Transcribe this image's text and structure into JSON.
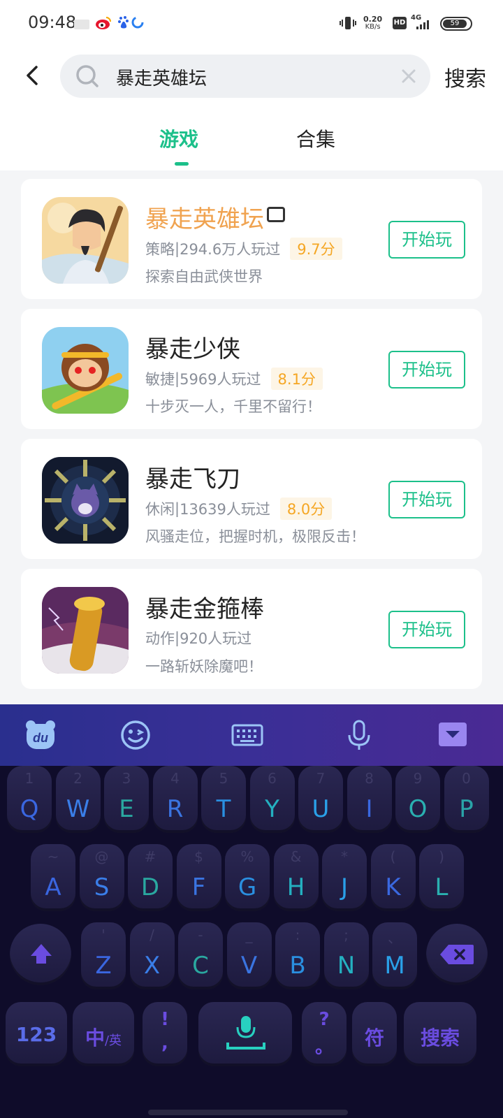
{
  "status": {
    "time": "09:48",
    "net_speed": "0.20",
    "net_unit": "KB/s",
    "hd": "HD",
    "signal": "4G",
    "battery": "59"
  },
  "header": {
    "search_value": "暴走英雄坛",
    "search_button": "搜索"
  },
  "tabs": [
    {
      "label": "游戏",
      "active": true
    },
    {
      "label": "合集",
      "active": false
    }
  ],
  "games": [
    {
      "name": "暴走英雄坛",
      "category": "策略",
      "players": "294.6万人玩过",
      "score": "9.7分",
      "desc": "探索自由武侠世界",
      "button": "开始玩"
    },
    {
      "name": "暴走少侠",
      "category": "敏捷",
      "players": "5969人玩过",
      "score": "8.1分",
      "desc": "十步灭一人，千里不留行！",
      "button": "开始玩"
    },
    {
      "name": "暴走飞刀",
      "category": "休闲",
      "players": "13639人玩过",
      "score": "8.0分",
      "desc": "风骚走位，把握时机，极限反击！",
      "button": "开始玩"
    },
    {
      "name": "暴走金箍棒",
      "category": "动作",
      "players": "920人玩过",
      "score": "",
      "desc": "一路斩妖除魔吧！",
      "button": "开始玩"
    }
  ],
  "meta_sep": " | ",
  "keyboard": {
    "row1": [
      {
        "k": "Q",
        "s": "1"
      },
      {
        "k": "W",
        "s": "2"
      },
      {
        "k": "E",
        "s": "3"
      },
      {
        "k": "R",
        "s": "4"
      },
      {
        "k": "T",
        "s": "5"
      },
      {
        "k": "Y",
        "s": "6"
      },
      {
        "k": "U",
        "s": "7"
      },
      {
        "k": "I",
        "s": "8"
      },
      {
        "k": "O",
        "s": "9"
      },
      {
        "k": "P",
        "s": "0"
      }
    ],
    "row2": [
      {
        "k": "A",
        "s": "~"
      },
      {
        "k": "S",
        "s": "@"
      },
      {
        "k": "D",
        "s": "#"
      },
      {
        "k": "F",
        "s": "$"
      },
      {
        "k": "G",
        "s": "%"
      },
      {
        "k": "H",
        "s": "&"
      },
      {
        "k": "J",
        "s": "*"
      },
      {
        "k": "K",
        "s": "("
      },
      {
        "k": "L",
        "s": ")"
      }
    ],
    "row3": [
      {
        "k": "Z",
        "s": "'"
      },
      {
        "k": "X",
        "s": "/"
      },
      {
        "k": "C",
        "s": "-"
      },
      {
        "k": "V",
        "s": "_"
      },
      {
        "k": "B",
        "s": ":"
      },
      {
        "k": "N",
        "s": ";"
      },
      {
        "k": "M",
        "s": "、"
      }
    ],
    "num_key": "123",
    "lang_key_main": "中",
    "lang_key_sub": "/英",
    "punct_top": "!",
    "punct_bottom": ",",
    "punct2_top": "?",
    "punct2_bottom": "。",
    "symbol_key": "符",
    "search_key": "搜索",
    "colors": [
      "#3a66e0",
      "#3a7ee8",
      "#2aa8a0",
      "#3a74e0",
      "#2a8fe0",
      "#24b0c0",
      "#2aa0e8",
      "#3a68e0",
      "#2ab0b0",
      "#2aa4a8"
    ]
  }
}
